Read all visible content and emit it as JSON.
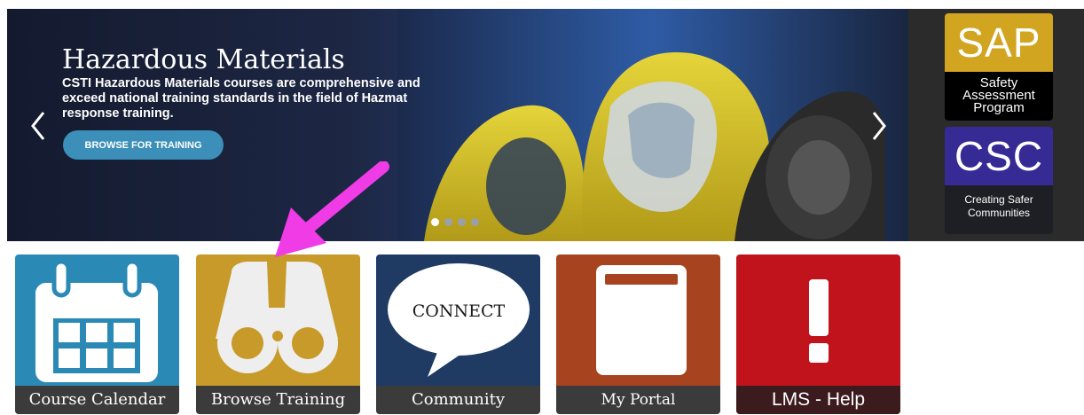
{
  "hero": {
    "title": "Hazardous Materials",
    "description": "CSTI Hazardous Materials courses are comprehensive and exceed national training standards in the field of Hazmat response training.",
    "button_label": "BROWSE FOR TRAINING",
    "slide_count": 4,
    "active_slide": 1
  },
  "side_panel": {
    "sap": {
      "acronym": "SAP",
      "line1": "Safety",
      "line2": "Assessment",
      "line3": "Program"
    },
    "csc": {
      "acronym": "CSC",
      "line1": "Creating Safer",
      "line2": "Communities"
    }
  },
  "tiles": [
    {
      "label": "Course Calendar",
      "icon": "calendar-icon"
    },
    {
      "label": "Browse Training",
      "icon": "binoculars-icon"
    },
    {
      "label": "Community",
      "icon": "speech-bubble-icon",
      "bubble_text": "CONNECT"
    },
    {
      "label": "My Portal",
      "icon": "book-icon"
    },
    {
      "label": "LMS - Help",
      "icon": "exclamation-icon"
    }
  ],
  "colors": {
    "calendar": "#2a8ab5",
    "browse": "#c79a2a",
    "community": "#1f3a63",
    "portal": "#a8431f",
    "help": "#c0131b",
    "annotation_arrow": "#f03ce6"
  }
}
